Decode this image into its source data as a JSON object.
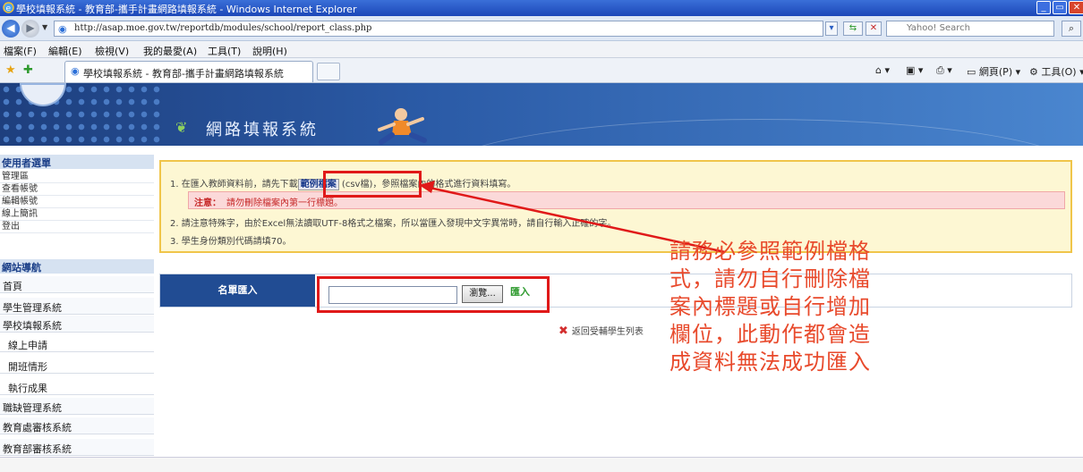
{
  "window": {
    "title": "學校填報系統 - 教育部-攜手計畫網路填報系統 - Windows Internet Explorer"
  },
  "address": {
    "url": "http://asap.moe.gov.tw/reportdb/modules/school/report_class.php",
    "search_placeholder": "Yahoo! Search"
  },
  "menu": [
    "檔案(F)",
    "編輯(E)",
    "檢視(V)",
    "我的最愛(A)",
    "工具(T)",
    "說明(H)"
  ],
  "tab": {
    "label": "學校填報系統 - 教育部-攜手計畫網路填報系統"
  },
  "tools": {
    "page": "網頁(P)",
    "tools": "工具(O)"
  },
  "site": {
    "title": "網路填報系統"
  },
  "sidebar": {
    "user_section": "使用者選單",
    "user_items": [
      "管理區",
      "查看帳號",
      "編輯帳號",
      "線上簡訊",
      "登出"
    ],
    "nav_section": "網站導航",
    "nav_items": [
      {
        "label": "首頁",
        "sub": false
      },
      {
        "label": "學生管理系統",
        "sub": false
      },
      {
        "label": "學校填報系統",
        "sub": false
      },
      {
        "label": "線上申請",
        "sub": true
      },
      {
        "label": "開班情形",
        "sub": true
      },
      {
        "label": "執行成果",
        "sub": true
      },
      {
        "label": "職缺管理系統",
        "sub": false
      },
      {
        "label": "教育處審核系統",
        "sub": false
      },
      {
        "label": "教育部審核系統",
        "sub": false
      }
    ]
  },
  "notice": {
    "line1_prefix": "1. 在匯入教師資料前，請先下載",
    "sample_link": "範例檔案",
    "line1_suffix": "(csv檔)，參照檔案內的格式進行資料填寫。",
    "warn_label": "注意：",
    "warn_text": "請勿刪除檔案內第一行標題。",
    "line2": "2. 請注意特殊字，由於Excel無法讀取UTF-8格式之檔案，所以當匯入發現中文字異常時，請自行輸入正確的字。",
    "line3": "3. 學生身份類別代碼請填70。"
  },
  "import": {
    "label": "名單匯入",
    "browse": "瀏覽...",
    "submit": "匯入"
  },
  "return_link": "返回受輔學生列表",
  "callout": [
    "請務必參照範例檔格",
    "式，請勿自行刪除檔",
    "案內標題或自行增加",
    "欄位，此動作都會造",
    "成資料無法成功匯入"
  ]
}
